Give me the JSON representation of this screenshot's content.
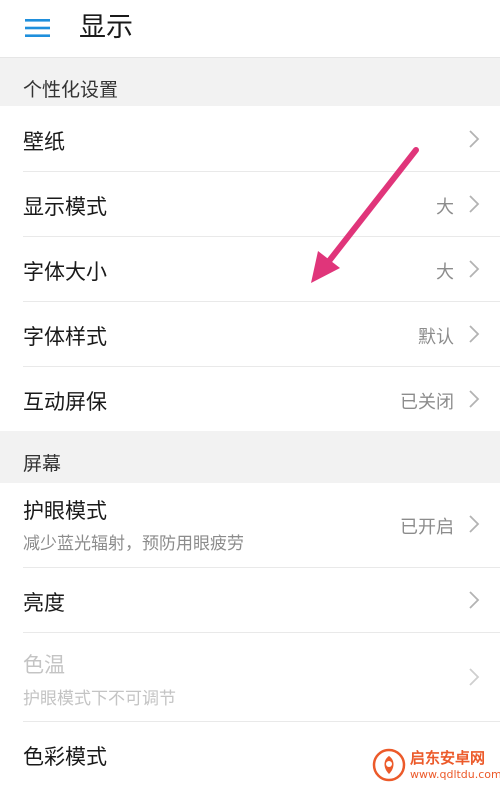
{
  "header": {
    "title": "显示",
    "menu_icon": "hamburger-menu-icon"
  },
  "sections": [
    {
      "title": "个性化设置",
      "items": [
        {
          "label": "壁纸",
          "value": ""
        },
        {
          "label": "显示模式",
          "value": "大"
        },
        {
          "label": "字体大小",
          "value": "大"
        },
        {
          "label": "字体样式",
          "value": "默认"
        },
        {
          "label": "互动屏保",
          "value": "已关闭"
        }
      ]
    },
    {
      "title": "屏幕",
      "items": [
        {
          "label": "护眼模式",
          "sublabel": "减少蓝光辐射，预防用眼疲劳",
          "value": "已开启"
        },
        {
          "label": "亮度",
          "value": ""
        },
        {
          "label": "色温",
          "sublabel": "护眼模式下不可调节",
          "value": "",
          "disabled": true
        },
        {
          "label": "色彩模式",
          "value": ""
        }
      ]
    }
  ],
  "annotation": {
    "arrow_color": "#e0357a"
  },
  "watermark": {
    "title": "启东安卓网",
    "url": "www.qdltdu.com",
    "color": "#ec5a2a"
  }
}
